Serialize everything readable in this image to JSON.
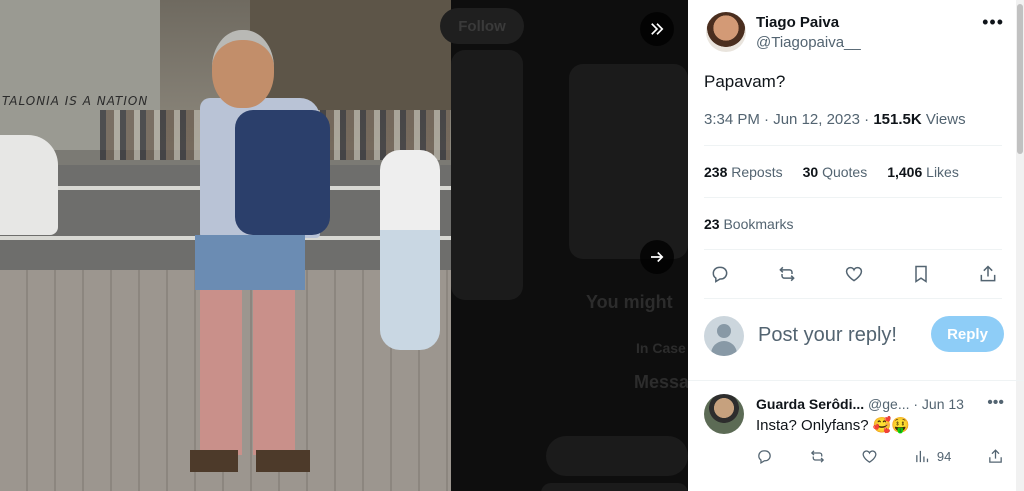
{
  "viewer": {
    "photo_wall_text": "TALONIA IS A NATION",
    "background_follow_label": "Follow",
    "background_heading": "You might",
    "background_user": "In Case",
    "background_message": "Messa"
  },
  "tweet": {
    "author_name": "Tiago Paiva",
    "author_handle": "@Tiagopaiva__",
    "text": "Papavam?",
    "time": "3:34 PM",
    "date": "Jun 12, 2023",
    "views_count": "151.5K",
    "views_label": "Views",
    "reposts_count": "238",
    "reposts_label": "Reposts",
    "quotes_count": "30",
    "quotes_label": "Quotes",
    "likes_count": "1,406",
    "likes_label": "Likes",
    "bookmarks_count": "23",
    "bookmarks_label": "Bookmarks"
  },
  "reply_box": {
    "placeholder": "Post your reply!",
    "button_label": "Reply"
  },
  "comment": {
    "name": "Guarda Serôdi...",
    "handle": "@ge...",
    "date": "· Jun 13",
    "text": "Insta? Onlyfans? 🥰🤑",
    "views": "94"
  },
  "icons": {
    "collapse": "double-chevron-right-icon",
    "next": "arrow-right-icon",
    "more": "more-dots-icon"
  },
  "colors": {
    "reply_button": "#8ecdf7",
    "secondary_text": "#536471",
    "primary_text": "#0f1419"
  }
}
